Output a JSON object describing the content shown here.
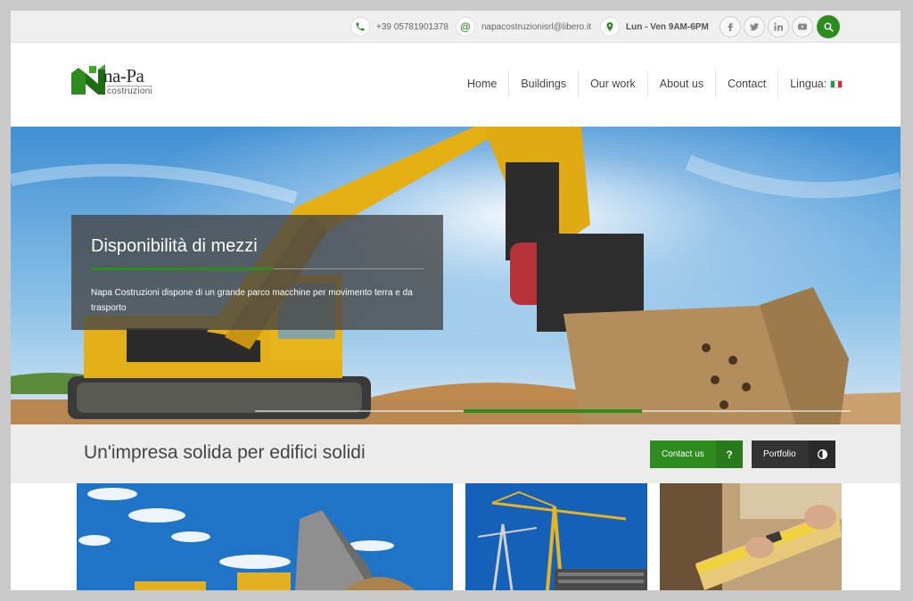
{
  "topbar": {
    "phone": "+39 05781901378",
    "email": "napacostruzionisrl@libero.it",
    "hours": "Lun - Ven 9AM-6PM",
    "phone_icon": "phone-icon",
    "email_icon": "at-icon",
    "hours_icon": "location-pin-icon",
    "social": [
      {
        "icon": "facebook-icon",
        "glyph": "f"
      },
      {
        "icon": "twitter-icon",
        "glyph": "t"
      },
      {
        "icon": "linkedin-icon",
        "glyph": "in"
      },
      {
        "icon": "youtube-icon",
        "glyph": "▶"
      }
    ],
    "search_icon": "search-icon"
  },
  "logo": {
    "brand": "na-Pa",
    "sub": "costruzioni"
  },
  "nav": {
    "items": [
      "Home",
      "Buildings",
      "Our work",
      "About us",
      "Contact",
      "Lingua:"
    ],
    "language_flag": "italian-flag-icon"
  },
  "hero": {
    "title": "Disponibilità di mezzi",
    "text": "Napa Costruzioni dispone di un grande parco macchine per movimento terra e da trasporto",
    "slider_progress": 0.3
  },
  "band": {
    "tagline": "Un'impresa solida per edifici solidi",
    "contact_label": "Contact us",
    "contact_icon": "?",
    "portfolio_label": "Portfolio",
    "portfolio_icon": "contrast-icon"
  },
  "colors": {
    "accent": "#2e8b1e",
    "dark_button": "#333333",
    "topbar": "#efefef",
    "band": "#ececec"
  }
}
